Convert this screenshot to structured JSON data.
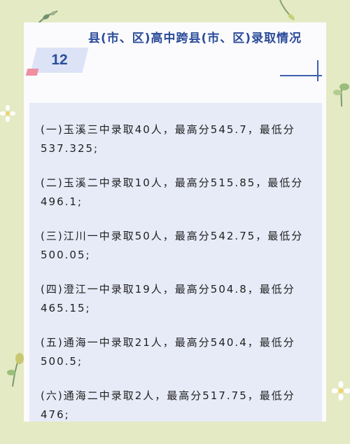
{
  "header": {
    "number": "12",
    "title": "县(市、区)高中跨县(市、区)录取情况"
  },
  "entries": [
    "(一)玉溪三中录取40人，最高分545.7，最低分537.325;",
    "(二)玉溪二中录取10人，最高分515.85，最低分496.1;",
    "(三)江川一中录取50人，最高分542.75，最低分500.05;",
    "(四)澄江一中录取19人，最高分504.8，最低分465.15;",
    "(五)通海一中录取21人，最高分540.4，最低分500.5;",
    "(六)通海二中录取2人，最高分517.75，最低分476;"
  ]
}
